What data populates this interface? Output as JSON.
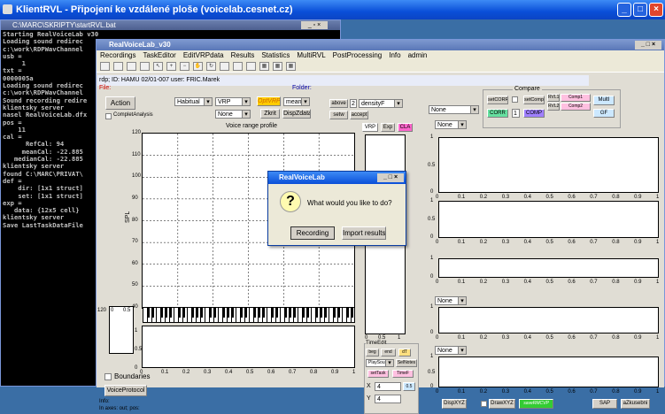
{
  "window": {
    "title": "KlientRVL - Připojení ke vzdálené ploše (voicelab.cesnet.cz)"
  },
  "cmd": {
    "title": "C:\\MARC\\SKRIPTY\\startRVL.bat",
    "lines": [
      "Starting RealVoiceLab v30",
      "Loading sound redirec",
      "c:\\work\\RDPWavChannel",
      "",
      "usb =",
      "",
      "     1",
      "",
      "",
      "txt =",
      "",
      "0000005a",
      "",
      "Loading sound redirec",
      "c:\\work\\RDPWavChannel",
      "Sound recording redire",
      "klientsky server",
      "nasel RealVoiceLab.dfx",
      "",
      "pos =",
      "",
      "    11",
      "",
      "",
      "cal =",
      "",
      "      RefCal: 94",
      "     meanCal: -22.885",
      "   medianCal: -22.885",
      "",
      "klientsky server",
      "found C:\\MARC\\PRIVAT\\",
      "",
      "def =",
      "",
      "    dir: [1x1 struct]",
      "    set: [1x1 struct]",
      "",
      "",
      "exp =",
      "",
      "   data: {12x5 cell}",
      "",
      "klientsky server",
      "Save LastTaskDataFile"
    ]
  },
  "rvl": {
    "title": "RealVoiceLab_v30",
    "menu": [
      "Recordings",
      "TaskEditor",
      "EditVRPdata",
      "Results",
      "Statistics",
      "MultiRVL",
      "PostProcessing",
      "Info",
      "admin"
    ]
  },
  "info": {
    "rdp": "rdp; ID: HAMU 02/01-007 user: FRIC.Marek",
    "file": "File:",
    "folder": "Folder:"
  },
  "controls": {
    "action": "Action",
    "complet": "CompletAnalysis",
    "habitual": "Habitual",
    "vrp": "VRP",
    "none": "None",
    "optvrp": "OptVRP",
    "mean": "mean",
    "zkrit": "Zkrit",
    "dispzdata": "DispZdata",
    "above": "above",
    "above_val": "2",
    "density": "densityF",
    "setw": "setw",
    "accept": "accept",
    "vrp_btn": "VRP",
    "exp_btn": "Exp",
    "cla_btn": "CLA"
  },
  "compare": {
    "title": "Compare",
    "setcorr": "setCORR",
    "corr": "CORR",
    "val": "1",
    "setcomp": "setComp",
    "comp": "COMP",
    "rvl1": "RVL1",
    "rvl2": "RVL2",
    "comp1": "Comp1",
    "comp2": "Comp2",
    "multi": "MultI",
    "gf": "GF",
    "none": "None"
  },
  "vrp_chart": {
    "title": "Voice range profile",
    "ylabel": "SPL",
    "yticks": [
      "120",
      "110",
      "100",
      "90",
      "80",
      "70",
      "60",
      "50",
      "40"
    ]
  },
  "axes_ticks": {
    "x": [
      "0",
      "0.1",
      "0.2",
      "0.3",
      "0.4",
      "0.5",
      "0.6",
      "0.7",
      "0.8",
      "0.9",
      "1"
    ],
    "y_sm": [
      "0",
      "0.5",
      "1"
    ],
    "left120": "120",
    "left0": "0",
    "left05": "0.5"
  },
  "right_none": [
    "None",
    "None",
    "None"
  ],
  "left_bottom": {
    "boundaries": "Boundaries",
    "voiceprotocol": "VoiceProtocol",
    "info": "Info:",
    "inaxes": "In axes: out; pos:"
  },
  "timeedit": {
    "title": "TimeEdit",
    "beg": "beg",
    "end": "end",
    "dt": "dT",
    "playsound": "PlaySound",
    "selnotes": "SelNotes",
    "settask": "setTask",
    "timef": "TimeF",
    "x": "X",
    "xval": "4",
    "y": "Y",
    "yval": "4",
    "g": "0.5"
  },
  "bottom": {
    "dispxyz": "DispXYZ",
    "drawxyz": "DrawXYZ",
    "saveright": "saveRMCVP",
    "sap": "SAP",
    "azkusebni": "aZkusebni"
  },
  "dialog": {
    "title": "RealVoiceLab",
    "question": "What would you like to do?",
    "recording": "Recording",
    "import": "Import results"
  },
  "colors": {
    "optvrp": "#ffcc00",
    "cla": "#ff66cc",
    "corr": "#66e0a0",
    "comp": "#a080ff",
    "save": "#33cc33"
  }
}
